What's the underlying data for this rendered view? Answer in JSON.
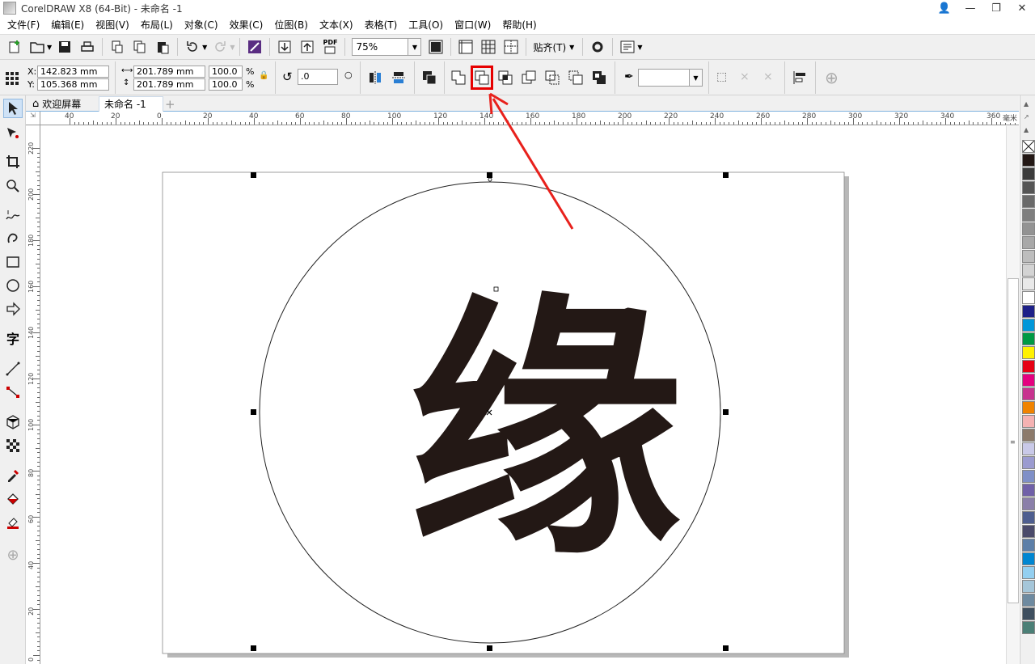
{
  "window": {
    "title": "CorelDRAW X8 (64-Bit) - 未命名 -1"
  },
  "menu": [
    "文件(F)",
    "编辑(E)",
    "视图(V)",
    "布局(L)",
    "对象(C)",
    "效果(C)",
    "位图(B)",
    "文本(X)",
    "表格(T)",
    "工具(O)",
    "窗口(W)",
    "帮助(H)"
  ],
  "toolbar": {
    "zoom": "75%",
    "snap_label": "贴齐(T)",
    "pdf_label": "PDF"
  },
  "property_bar": {
    "x_label": "X:",
    "x_value": "142.823 mm",
    "y_label": "Y:",
    "y_value": "105.368 mm",
    "width_value": "201.789 mm",
    "height_value": "201.789 mm",
    "scale_x": "100.0",
    "scale_y": "100.0",
    "percent": "%",
    "rotation": ".0"
  },
  "tabs": {
    "welcome": "欢迎屏幕",
    "document": "未命名 -1"
  },
  "ruler": {
    "unit": "毫米",
    "h_ticks": [
      "40",
      "20",
      "0",
      "20",
      "40",
      "60",
      "80",
      "100",
      "120",
      "140",
      "160",
      "180",
      "200",
      "220",
      "240",
      "260",
      "280",
      "300",
      "320",
      "340",
      "360"
    ],
    "v_ticks": [
      "220",
      "200",
      "180",
      "160",
      "140",
      "120",
      "100",
      "80",
      "60",
      "40",
      "20",
      "0"
    ]
  },
  "artwork": {
    "glyph": "缘",
    "glyph_color": "#231815"
  },
  "palette": [
    "#231815",
    "#3c3c3c",
    "#555555",
    "#6a6a6a",
    "#7e7e7e",
    "#939393",
    "#a8a8a8",
    "#bdbdbd",
    "#d3d3d3",
    "#e9e9e9",
    "#ffffff",
    "#1d2088",
    "#0097d9",
    "#009944",
    "#fff100",
    "#e60012",
    "#e4007f",
    "#c8338f",
    "#f08300",
    "#f5b2b2",
    "#8c7a6b",
    "#c9c9e8",
    "#9b9bd0",
    "#7f8fc7",
    "#7060a8",
    "#8a7fa9",
    "#4e5e8f",
    "#4a4a6a",
    "#5c7fa8",
    "#0086d1",
    "#93cff0",
    "#a5c6d9",
    "#6e8aa0",
    "#3f4f5f",
    "#4b7f76"
  ],
  "colors": {
    "accent_highlight": "#e60000",
    "arrow": "#e8211c"
  }
}
